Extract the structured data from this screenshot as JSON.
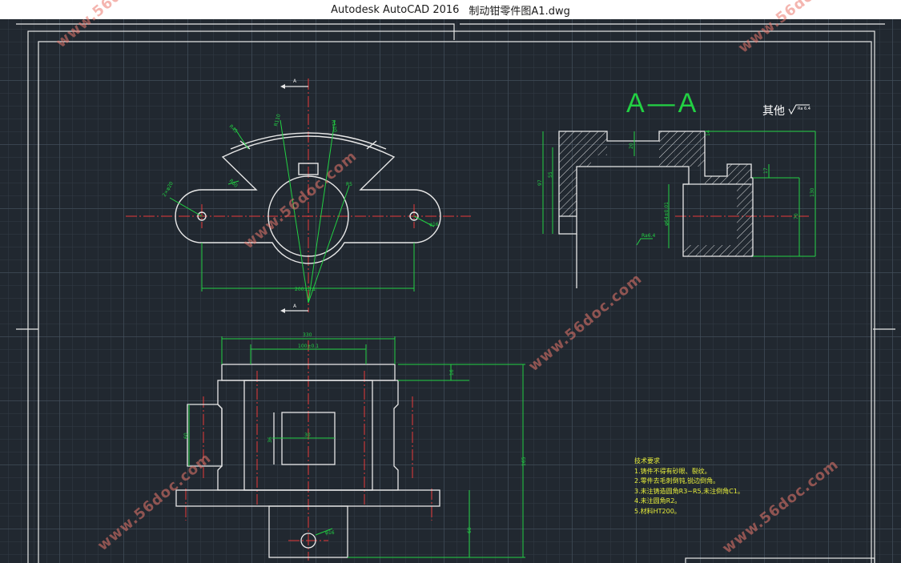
{
  "window": {
    "app_title": "Autodesk AutoCAD 2016",
    "file_name": "制动钳零件图A1.dwg"
  },
  "watermark_text": "www.56doc.com",
  "section": {
    "title": "A—A",
    "roughness_label": "其他",
    "roughness_value": "Ra 6.4"
  },
  "dimensions": {
    "cut_mark": "A",
    "top_view_span": "200±0.1",
    "front_width": "330",
    "front_inner_width": "100±0.1",
    "front_height": "165",
    "front_flange": "16",
    "front_slot_height": "60",
    "front_window": "30",
    "front_window_v": "36",
    "front_base": "60",
    "hole_diameter": "φ16",
    "section_height_total": "130",
    "section_height_left": "97",
    "section_inner_left": "55",
    "section_bore": "φ64±0.01",
    "section_right_h": "70",
    "section_top_gap": "20",
    "section_step": "17",
    "section_small": "14",
    "section_roughness": "Ra6.4",
    "arc_r1": "R110",
    "arc_r2": "R120",
    "hole_left": "2×φ20",
    "hole_right": "φ16",
    "center_r": "R5",
    "center_r2": "R25",
    "slot_w": "R45",
    "left_r": "R60"
  },
  "tech_requirements": {
    "heading": "技术要求",
    "items": [
      "1.铸件不得有砂眼、裂纹。",
      "2.零件去毛刺倒钝,锐边倒角。",
      "3.未注铸造圆角R3~R5,未注倒角C1。",
      "4.未注圆角R2。",
      "5.材料HT200。"
    ]
  },
  "colors": {
    "background": "#212830",
    "geometry": "#e8e8e8",
    "dimension": "#22d043",
    "centerline": "#e83a3a",
    "notes": "#e8ef3a"
  }
}
